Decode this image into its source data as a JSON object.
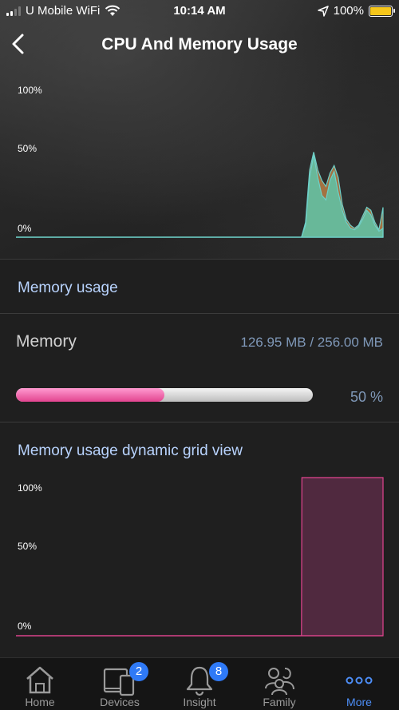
{
  "status_bar": {
    "carrier": "U Mobile WiFi",
    "time": "10:14 AM",
    "battery": "100%"
  },
  "header": {
    "title": "CPU And Memory Usage",
    "back_icon": "chevron-left-icon"
  },
  "cpu_chart": {
    "y_ticks": [
      "100%",
      "50%",
      "0%"
    ]
  },
  "memory_section": {
    "title": "Memory usage",
    "label": "Memory",
    "value": "126.95 MB / 256.00 MB",
    "percent_text": "50 %",
    "percent": 0.5
  },
  "grid_section": {
    "title": "Memory usage dynamic grid view",
    "y_ticks": [
      "100%",
      "50%",
      "0%"
    ]
  },
  "tabs": [
    {
      "label": "Home",
      "icon": "home-icon"
    },
    {
      "label": "Devices",
      "icon": "devices-icon",
      "badge": "2"
    },
    {
      "label": "Insight",
      "icon": "bell-icon",
      "badge": "8"
    },
    {
      "label": "Family",
      "icon": "family-icon"
    },
    {
      "label": "More",
      "icon": "more-icon",
      "active": true
    }
  ],
  "colors": {
    "accent": "#4d8ef7",
    "cpu_teal": "#5ec4a8",
    "cpu_orange": "#b07a45",
    "memory_pink": "#e2448f"
  },
  "chart_data": [
    {
      "type": "area",
      "y_unit": "%",
      "ylim": [
        0,
        100
      ],
      "x": [
        0,
        70,
        71,
        72,
        73,
        74,
        75,
        76,
        77,
        78,
        79,
        80,
        81,
        82,
        83,
        84,
        85,
        86,
        87,
        88,
        89,
        90
      ],
      "series": [
        {
          "values": [
            0,
            0,
            10,
            45,
            57,
            45,
            38,
            34,
            43,
            48,
            40,
            22,
            12,
            8,
            6,
            8,
            14,
            20,
            18,
            10,
            5,
            20
          ]
        },
        {
          "values": [
            0,
            0,
            8,
            40,
            55,
            40,
            28,
            25,
            38,
            44,
            30,
            18,
            10,
            6,
            5,
            7,
            12,
            18,
            15,
            8,
            4,
            6
          ]
        }
      ]
    },
    {
      "type": "area",
      "y_unit": "%",
      "ylim": [
        0,
        100
      ],
      "x": [
        0,
        70,
        70.1,
        90
      ],
      "series": [
        {
          "values": [
            0,
            0,
            100,
            100
          ]
        }
      ]
    }
  ]
}
